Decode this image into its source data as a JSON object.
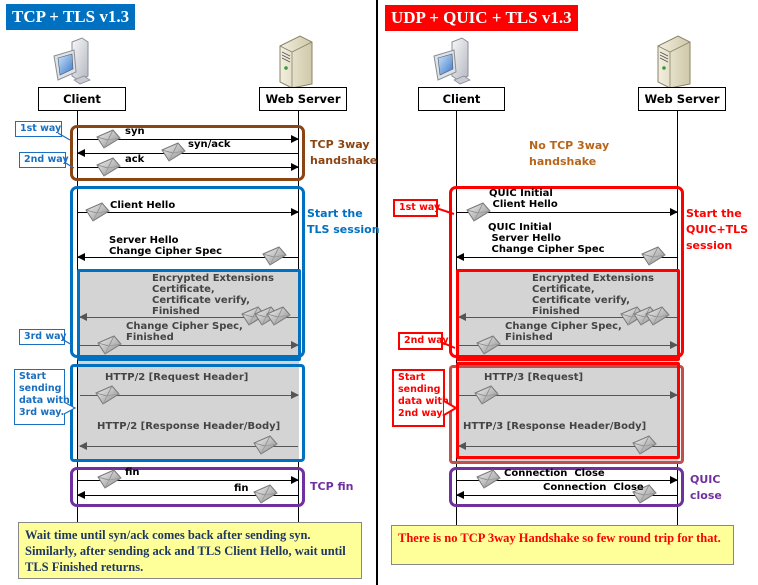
{
  "left_panel": {
    "title": "TCP + TLS v1.3",
    "title_color": "#0070c0",
    "client_label": "Client",
    "server_label": "Web Server",
    "messages": {
      "syn": "syn",
      "syn_ack": "syn/ack",
      "ack": "ack",
      "client_hello": "Client Hello",
      "server_hello": "Server Hello\nChange Cipher Spec",
      "encrypted": "Encrypted Extensions\nCertificate,\nCertificate verify,\nFinished",
      "client_finished": "Change Cipher Spec,\nFinished",
      "http_request": "HTTP/2 [Request Header]",
      "http_response": "HTTP/2 [Response Header/Body]",
      "fin_out": "fin",
      "fin_in": "fin"
    },
    "side_labels": {
      "handshake": "TCP 3way\nhandshake",
      "tls_session": "Start the\nTLS session",
      "fin": "TCP fin"
    },
    "callouts": {
      "first_way": "1st way",
      "second_way": "2nd way",
      "third_way": "3rd way",
      "start_sending": "Start\nsending\ndata with\n3rd way."
    },
    "note": "Wait time until syn/ack comes back after sending syn. Similarly, after sending ack and TLS Client Hello, wait until TLS Finished returns."
  },
  "right_panel": {
    "title": "UDP + QUIC + TLS v1.3",
    "title_color": "#ff0000",
    "client_label": "Client",
    "server_label": "Web Server",
    "no_handshake": "No TCP 3way\nhandshake",
    "messages": {
      "client_hello": "QUIC Initial\n Client Hello",
      "server_hello": "QUIC Initial\n Server Hello\n Change Cipher Spec",
      "encrypted": "Encrypted Extensions\nCertificate,\nCertificate verify,\nFinished",
      "client_finished": "Change Cipher Spec,\nFinished",
      "http_request": "HTTP/3 [Request]",
      "http_response": "HTTP/3 [Response Header/Body]",
      "close_out": "Connection  Close",
      "close_in": "Connection  Close"
    },
    "side_labels": {
      "session": "Start the\nQUIC+TLS\nsession",
      "close": "QUIC\nclose"
    },
    "callouts": {
      "first_way": "1st way",
      "second_way": "2nd way",
      "start_sending": "Start\nsending\ndata with\n2nd way."
    },
    "note": "There is no TCP 3way Handshake so few round trip for that."
  },
  "colors": {
    "tcp_handshake": "#8b4513",
    "tls_blue": "#0070c0",
    "quic_red": "#ff0000",
    "fin_purple": "#7030a0",
    "note_bg": "#ffff99",
    "gray_region": "#d4d4d4"
  }
}
